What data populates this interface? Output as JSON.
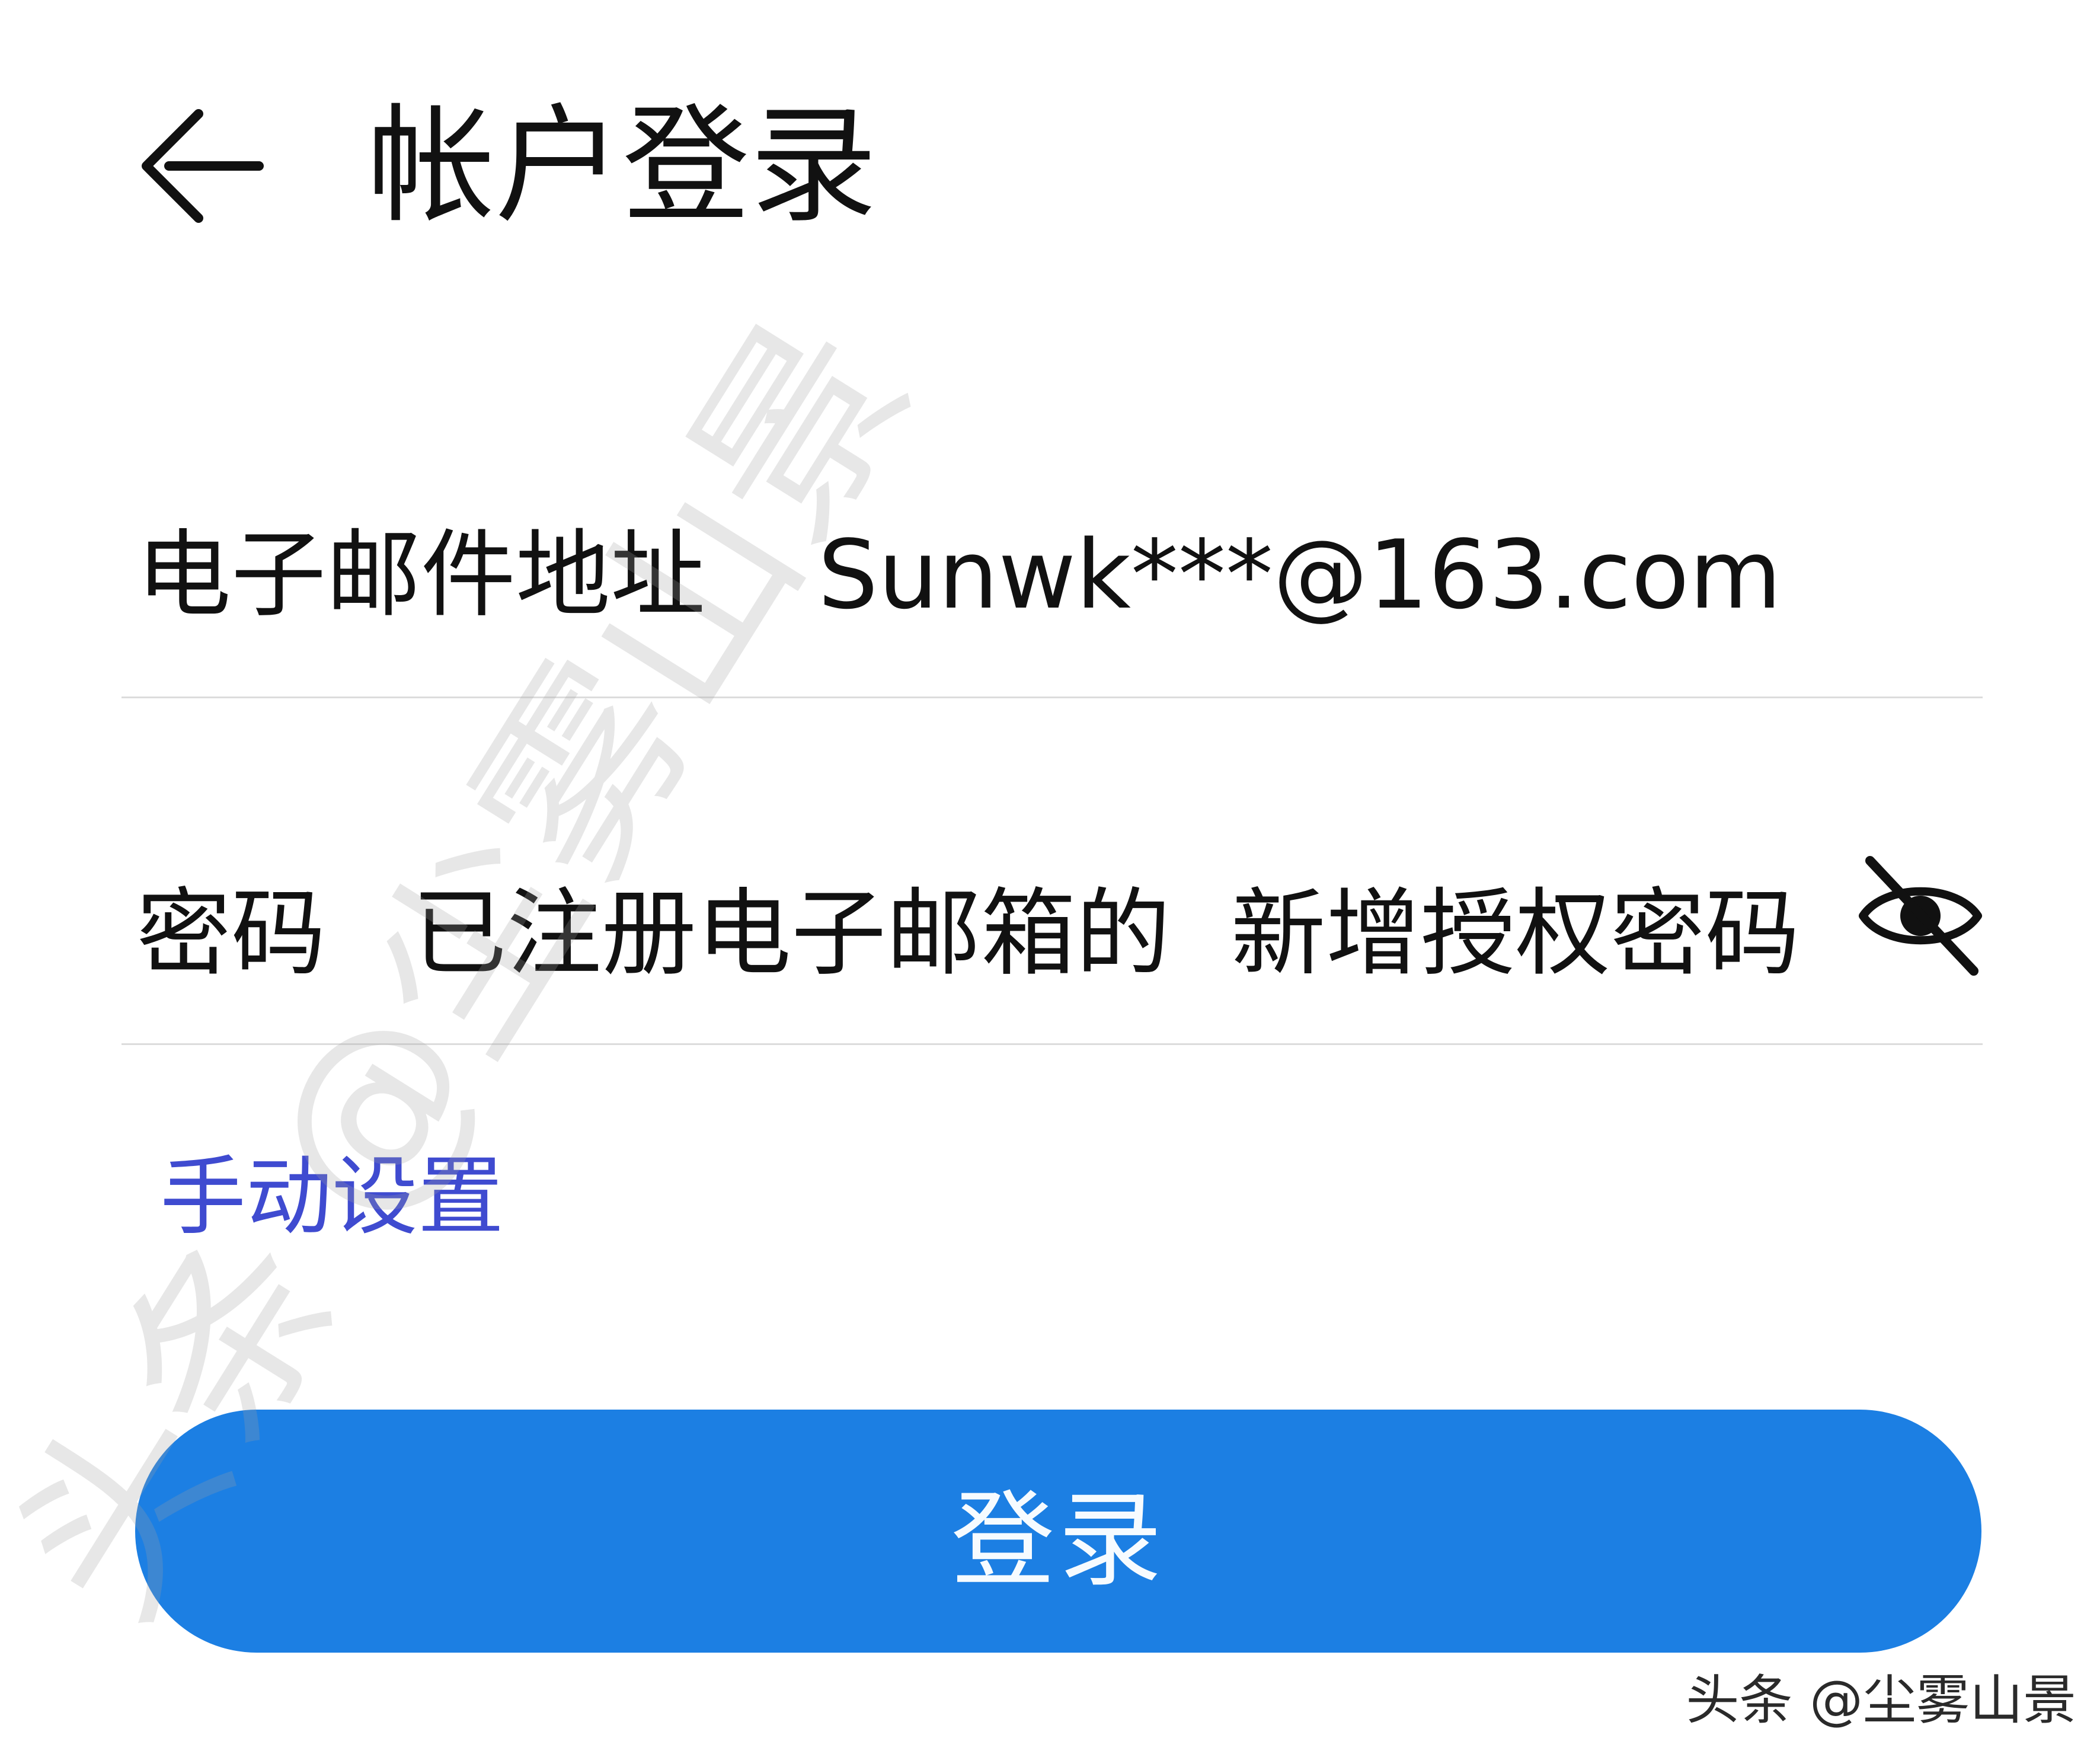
{
  "header": {
    "back_icon": "arrow-left-icon",
    "title": "帐户登录"
  },
  "form": {
    "email": {
      "label": "电子邮件地址",
      "value": "Sunwk***@163.com"
    },
    "password": {
      "label": "密码",
      "value": "已注册电子邮箱的  新增授权密码",
      "visibility_icon": "eye-off-icon"
    },
    "manual_setup_label": "手动设置",
    "login_label": "登录"
  },
  "overlays": {
    "diagonal_watermark": "头条 @尘雾山景",
    "source_mark": "头条 @尘雾山景"
  },
  "colors": {
    "accent": "#1c7fe3",
    "link": "#3f4bd0",
    "divider": "#dcdcdc",
    "text": "#111111"
  }
}
